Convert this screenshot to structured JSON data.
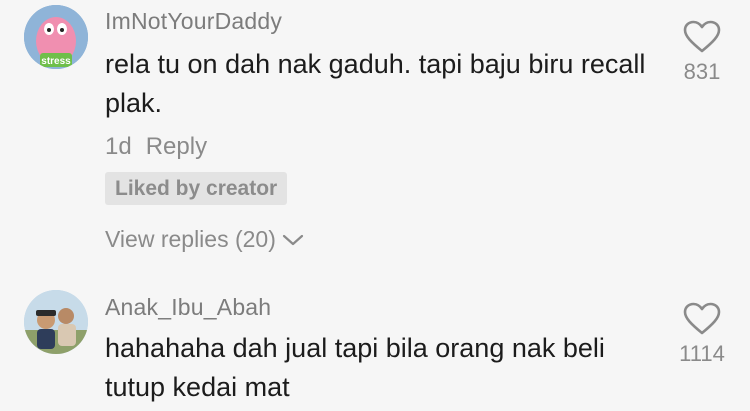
{
  "comments": [
    {
      "username": "ImNotYourDaddy",
      "avatar_text": "stress",
      "text": "rela tu on dah nak gaduh. tapi baju biru recall plak.",
      "time": "1d",
      "reply_label": "Reply",
      "liked_badge": "Liked by creator",
      "view_replies": "View replies (20)",
      "like_count": "831"
    },
    {
      "username": "Anak_Ibu_Abah",
      "text": "hahahaha dah jual tapi bila orang nak beli tutup kedai mat",
      "like_count": "1114"
    }
  ],
  "colors": {
    "background": "#f6f6f6",
    "secondary_text": "#8a8a8a",
    "primary_text": "#1c1c1c",
    "badge_bg": "#e3e3e3"
  },
  "icons": [
    "heart-icon",
    "chevron-down-icon"
  ]
}
